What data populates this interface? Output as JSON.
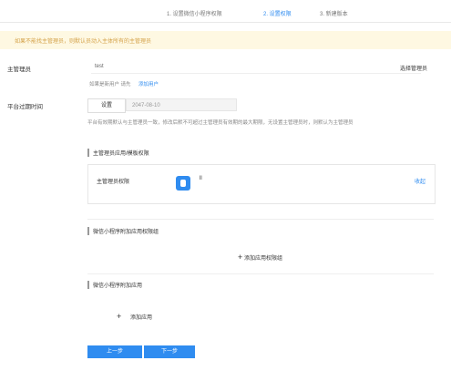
{
  "steps": [
    {
      "label": "1. 设置微信小程序权限",
      "active": false
    },
    {
      "label": "2. 设置权限",
      "active": true
    },
    {
      "label": "3. 新建版本",
      "active": false
    }
  ],
  "notice": {
    "text": "如果不能找主管理员，则默认员动入主体所有的主管理员"
  },
  "admin": {
    "label": "主管理员",
    "value": "test",
    "select_label": "选择管理员",
    "hint_prefix": "如果是新用户 请先",
    "hint_link": "添加用户"
  },
  "expiry": {
    "label": "平台过期时间",
    "set_label": "设置",
    "date": "2047-08-10",
    "description": "平台有效期默认与主管理员一致，修改后默不可超过主管理员有效期的最大期限，无设置主管理员时，则默认为主管理员"
  },
  "sections": {
    "admin_perm_title": "主管理员应用/模板权限",
    "mini_perm_title": "微信小程序附加应用权限组",
    "mini_app_title": "微信小程序附加应用"
  },
  "perm_card": {
    "label": "主管理员权限",
    "app_name": "ll",
    "collapse_label": "收起"
  },
  "actions": {
    "add_perm_group": "添加应用权限组",
    "add_app": "添加应用",
    "prev": "上一步",
    "next": "下一步"
  },
  "colors": {
    "accent": "#2f8cf0",
    "notice_bg": "#fef8e2",
    "notice_text": "#d4a24a"
  }
}
